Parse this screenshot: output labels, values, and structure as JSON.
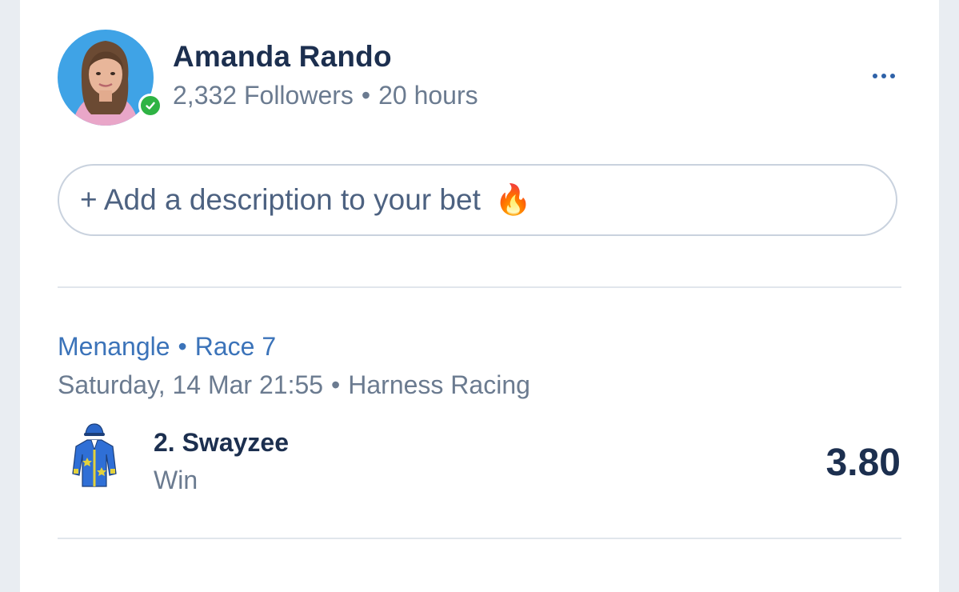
{
  "post": {
    "user_name": "Amanda Rando",
    "followers": "2,332 Followers",
    "separator": "•",
    "time_ago": "20 hours",
    "verified_icon": "check-icon",
    "more_icon": "ellipsis-icon"
  },
  "description": {
    "placeholder": "+ Add a description to your bet",
    "emoji": "🔥"
  },
  "race": {
    "venue": "Menangle",
    "separator": "•",
    "race": "Race 7",
    "datetime": "Saturday, 14 Mar 21:55",
    "category": "Harness Racing"
  },
  "selection": {
    "runner": "2. Swayzee",
    "bet_type": "Win",
    "odds": "3.80"
  },
  "colors": {
    "accent": "#3b73b9",
    "name": "#1c2f4f",
    "muted": "#6b7b90",
    "verified": "#2fb344"
  }
}
